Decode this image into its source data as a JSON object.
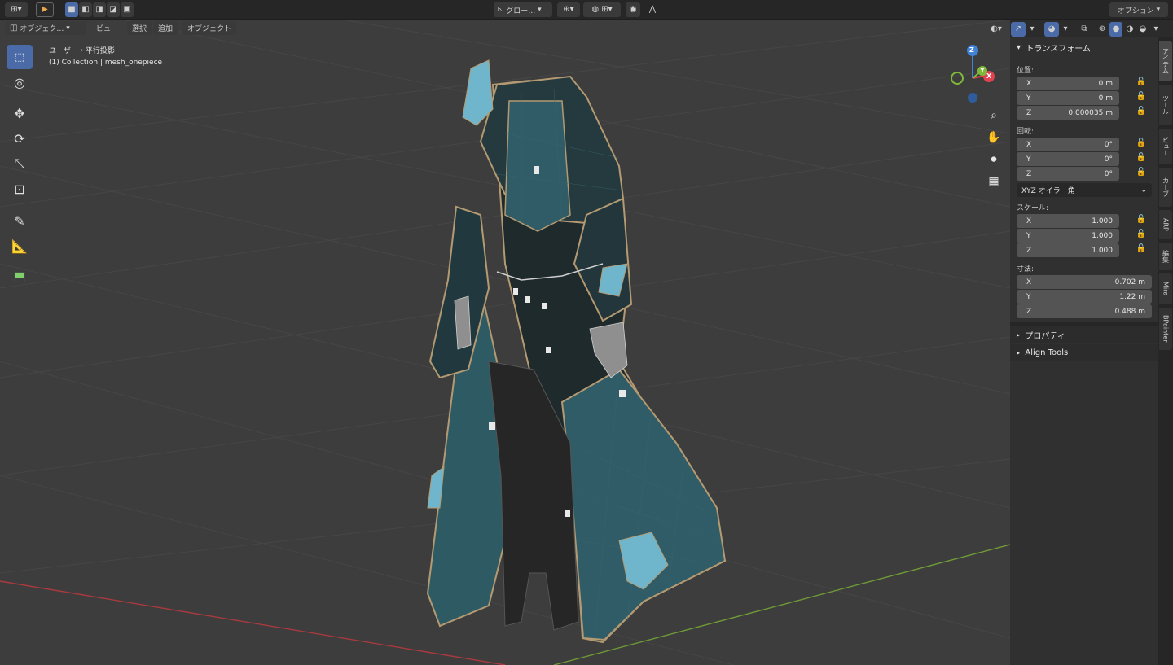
{
  "header": {
    "mode_icons": [
      "editor-type-icon",
      "select-box-icon",
      "select-mode-icons"
    ],
    "orientation_label": "グロー…",
    "options_label": "オプション"
  },
  "menubar": {
    "mode_label": "オブジェク…",
    "items": [
      "ビュー",
      "選択",
      "追加",
      "オブジェクト"
    ]
  },
  "viewport": {
    "view_name": "ユーザー・平行投影",
    "collection_info": "(1) Collection | mesh_onepiece",
    "gizmo": {
      "z": "Z",
      "y": "Y",
      "x": "X"
    }
  },
  "sidebar": {
    "panel_title": "トランスフォーム",
    "location_label": "位置:",
    "location": [
      {
        "axis": "X",
        "value": "0 m"
      },
      {
        "axis": "Y",
        "value": "0 m"
      },
      {
        "axis": "Z",
        "value": "0.000035 m"
      }
    ],
    "rotation_label": "回転:",
    "rotation": [
      {
        "axis": "X",
        "value": "0°"
      },
      {
        "axis": "Y",
        "value": "0°"
      },
      {
        "axis": "Z",
        "value": "0°"
      }
    ],
    "rotation_mode": "XYZ オイラー角",
    "scale_label": "スケール:",
    "scale": [
      {
        "axis": "X",
        "value": "1.000"
      },
      {
        "axis": "Y",
        "value": "1.000"
      },
      {
        "axis": "Z",
        "value": "1.000"
      }
    ],
    "dimensions_label": "寸法:",
    "dimensions": [
      {
        "axis": "X",
        "value": "0.702 m"
      },
      {
        "axis": "Y",
        "value": "1.22 m"
      },
      {
        "axis": "Z",
        "value": "0.488 m"
      }
    ],
    "properties_label": "プロパティ",
    "align_tools_label": "Align Tools"
  },
  "tabs": [
    "アイテム",
    "ツール",
    "ビュー",
    "カーブ",
    "ARP",
    "編集",
    "Mira",
    "BPainter"
  ],
  "colors": {
    "accent": "#4a6aa8",
    "x_axis": "#e0424f",
    "y_axis": "#7fb83a",
    "z_axis": "#3f82d6",
    "cloth_teal": "#2f5c66",
    "cloth_dark": "#1c1c1c",
    "trim_gold": "#b49a72"
  }
}
